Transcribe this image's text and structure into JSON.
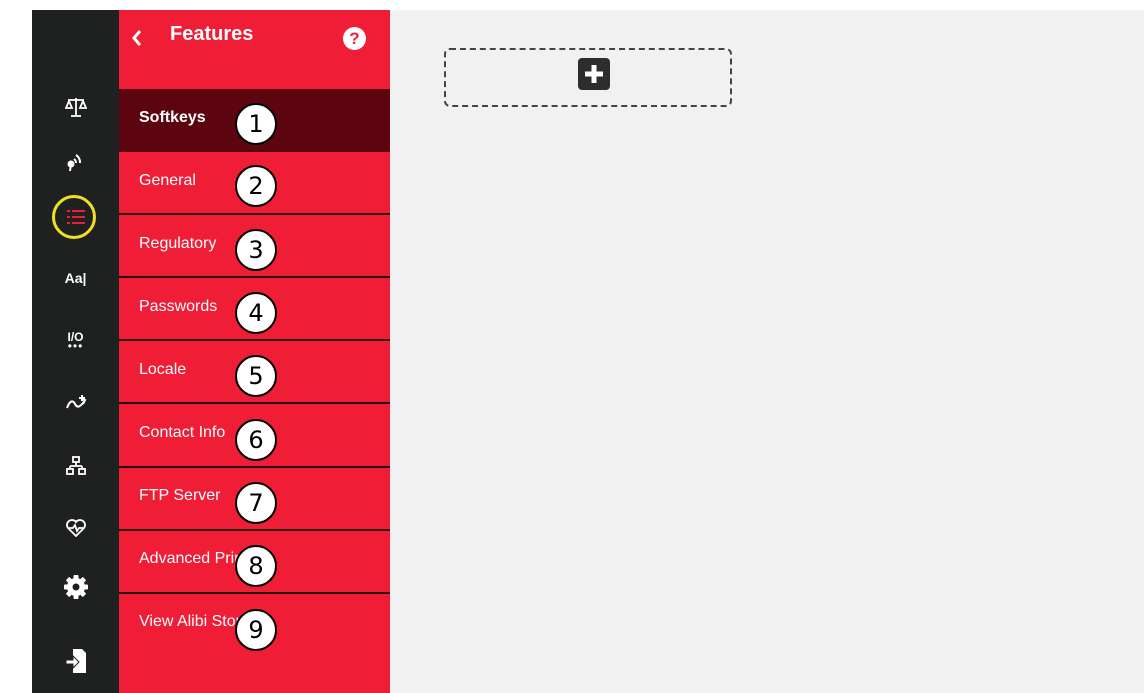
{
  "colors": {
    "accent": "#ef1d36",
    "active": "#5c0510",
    "sidebar": "#1f2121",
    "highlight": "#f0e020"
  },
  "iconbar": {
    "items": [
      {
        "name": "scale-icon"
      },
      {
        "name": "wireless-icon"
      },
      {
        "name": "features-list-icon",
        "selected": true
      },
      {
        "name": "font-icon",
        "text": "Aa|"
      },
      {
        "name": "io-icon",
        "text": "I/O",
        "dots": "•••"
      },
      {
        "name": "flow-icon"
      },
      {
        "name": "hierarchy-icon"
      },
      {
        "name": "health-icon"
      },
      {
        "name": "gear-icon"
      },
      {
        "name": "export-icon"
      }
    ]
  },
  "panel": {
    "title": "Features",
    "help": "?",
    "items": [
      {
        "label": "Softkeys",
        "num": "1",
        "active": true
      },
      {
        "label": "General",
        "num": "2"
      },
      {
        "label": "Regulatory",
        "num": "3"
      },
      {
        "label": "Passwords",
        "num": "4"
      },
      {
        "label": "Locale",
        "num": "5"
      },
      {
        "label": "Contact Info",
        "num": "6"
      },
      {
        "label": "FTP Server",
        "num": "7"
      },
      {
        "label": "Advanced Printing",
        "num": "8"
      },
      {
        "label": "View Alibi Storage",
        "num": "9"
      }
    ]
  }
}
